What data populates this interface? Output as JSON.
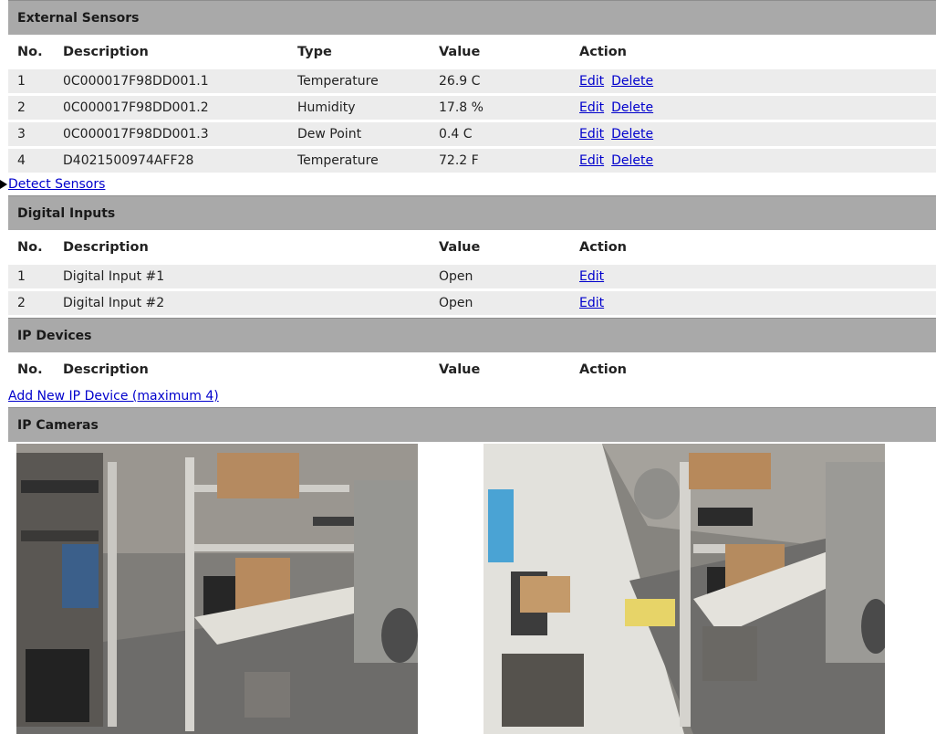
{
  "external_sensors": {
    "title": "External Sensors",
    "headers": {
      "no": "No.",
      "description": "Description",
      "type": "Type",
      "value": "Value",
      "action": "Action"
    },
    "rows": [
      {
        "no": "1",
        "description": "0C000017F98DD001.1",
        "type": "Temperature",
        "value": "26.9 C"
      },
      {
        "no": "2",
        "description": "0C000017F98DD001.2",
        "type": "Humidity",
        "value": "17.8 %"
      },
      {
        "no": "3",
        "description": "0C000017F98DD001.3",
        "type": "Dew Point",
        "value": "0.4 C"
      },
      {
        "no": "4",
        "description": "D4021500974AFF28",
        "type": "Temperature",
        "value": "72.2 F"
      }
    ],
    "edit_label": "Edit",
    "delete_label": "Delete",
    "detect_link": "Detect Sensors"
  },
  "digital_inputs": {
    "title": "Digital Inputs",
    "headers": {
      "no": "No.",
      "description": "Description",
      "value": "Value",
      "action": "Action"
    },
    "rows": [
      {
        "no": "1",
        "description": "Digital Input #1",
        "value": "Open"
      },
      {
        "no": "2",
        "description": "Digital Input #2",
        "value": "Open"
      }
    ],
    "edit_label": "Edit"
  },
  "ip_devices": {
    "title": "IP Devices",
    "headers": {
      "no": "No.",
      "description": "Description",
      "value": "Value",
      "action": "Action"
    },
    "add_link": "Add New IP Device (maximum 4)"
  },
  "ip_cameras": {
    "title": "IP Cameras"
  },
  "colors": {
    "section_header_bg": "#a9a9a9",
    "row_bg": "#ececec",
    "link": "#0000cc"
  }
}
